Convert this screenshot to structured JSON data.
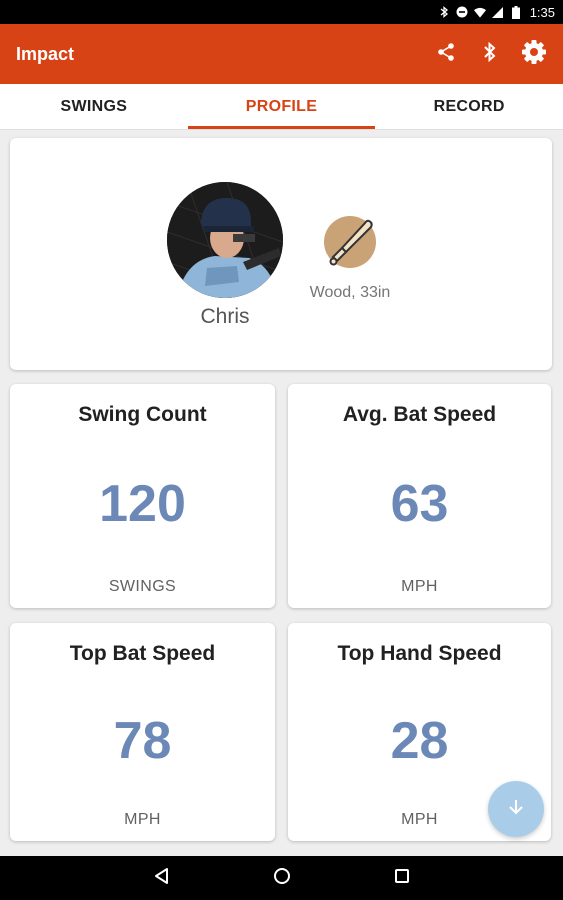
{
  "status_bar": {
    "time": "1:35"
  },
  "app_bar": {
    "title": "Impact"
  },
  "tabs": [
    {
      "label": "SWINGS",
      "active": false
    },
    {
      "label": "PROFILE",
      "active": true
    },
    {
      "label": "RECORD",
      "active": false
    }
  ],
  "profile": {
    "name": "Chris",
    "bat": "Wood, 33in"
  },
  "stats": [
    {
      "title": "Swing Count",
      "value": "120",
      "unit": "SWINGS"
    },
    {
      "title": "Avg. Bat Speed",
      "value": "63",
      "unit": "MPH"
    },
    {
      "title": "Top Bat Speed",
      "value": "78",
      "unit": "MPH"
    },
    {
      "title": "Top Hand Speed",
      "value": "28",
      "unit": "MPH"
    }
  ],
  "colors": {
    "app_bar": "#d84315",
    "accent": "#d84315",
    "stat_value": "#6b88b6",
    "fab": "#a9cde8",
    "bat_badge": "#c9a276"
  },
  "icons": {
    "app_bar": [
      "share-icon",
      "bluetooth-icon",
      "gear-icon"
    ],
    "fab": "arrow-down-icon",
    "nav": [
      "back-icon",
      "home-icon",
      "recents-icon"
    ]
  }
}
